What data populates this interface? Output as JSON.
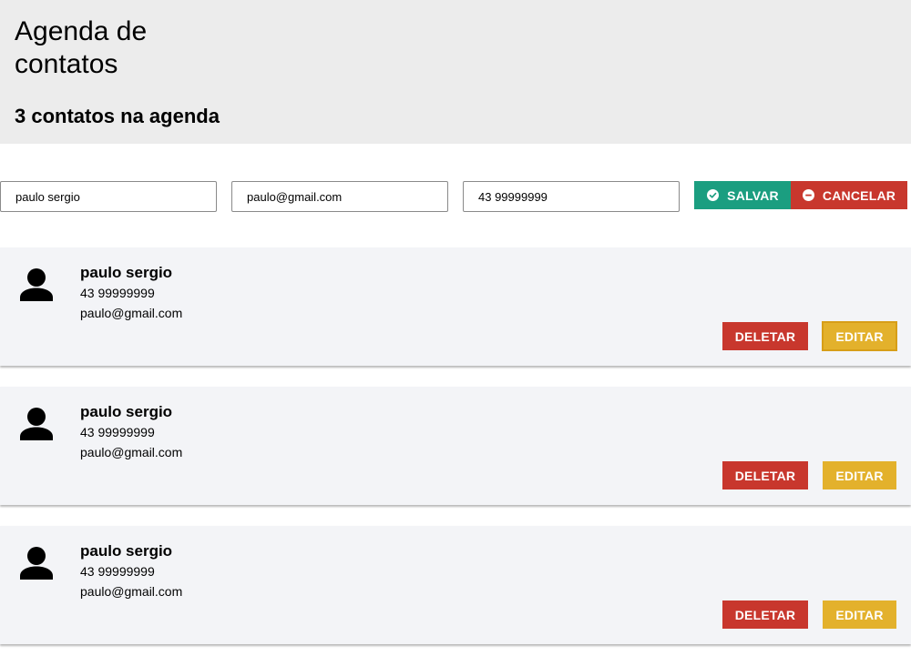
{
  "header": {
    "title": "Agenda de contatos",
    "count_text": "3 contatos na agenda"
  },
  "form": {
    "name_value": "paulo sergio",
    "email_value": "paulo@gmail.com",
    "phone_value": "43 99999999",
    "save_label": "SALVAR",
    "cancel_label": "CANCELAR",
    "save_icon": "check-circle-icon",
    "cancel_icon": "minus-circle-icon"
  },
  "contacts": [
    {
      "name": "paulo sergio",
      "phone": "43 99999999",
      "email": "paulo@gmail.com",
      "delete_label": "DELETAR",
      "edit_label": "EDITAR"
    },
    {
      "name": "paulo sergio",
      "phone": "43 99999999",
      "email": "paulo@gmail.com",
      "delete_label": "DELETAR",
      "edit_label": "EDITAR"
    },
    {
      "name": "paulo sergio",
      "phone": "43 99999999",
      "email": "paulo@gmail.com",
      "delete_label": "DELETAR",
      "edit_label": "EDITAR"
    }
  ],
  "colors": {
    "header_bg": "#ececec",
    "card_bg": "#f3f4f7",
    "save": "#1b9e80",
    "danger": "#c8372d",
    "edit": "#e3b12c"
  }
}
